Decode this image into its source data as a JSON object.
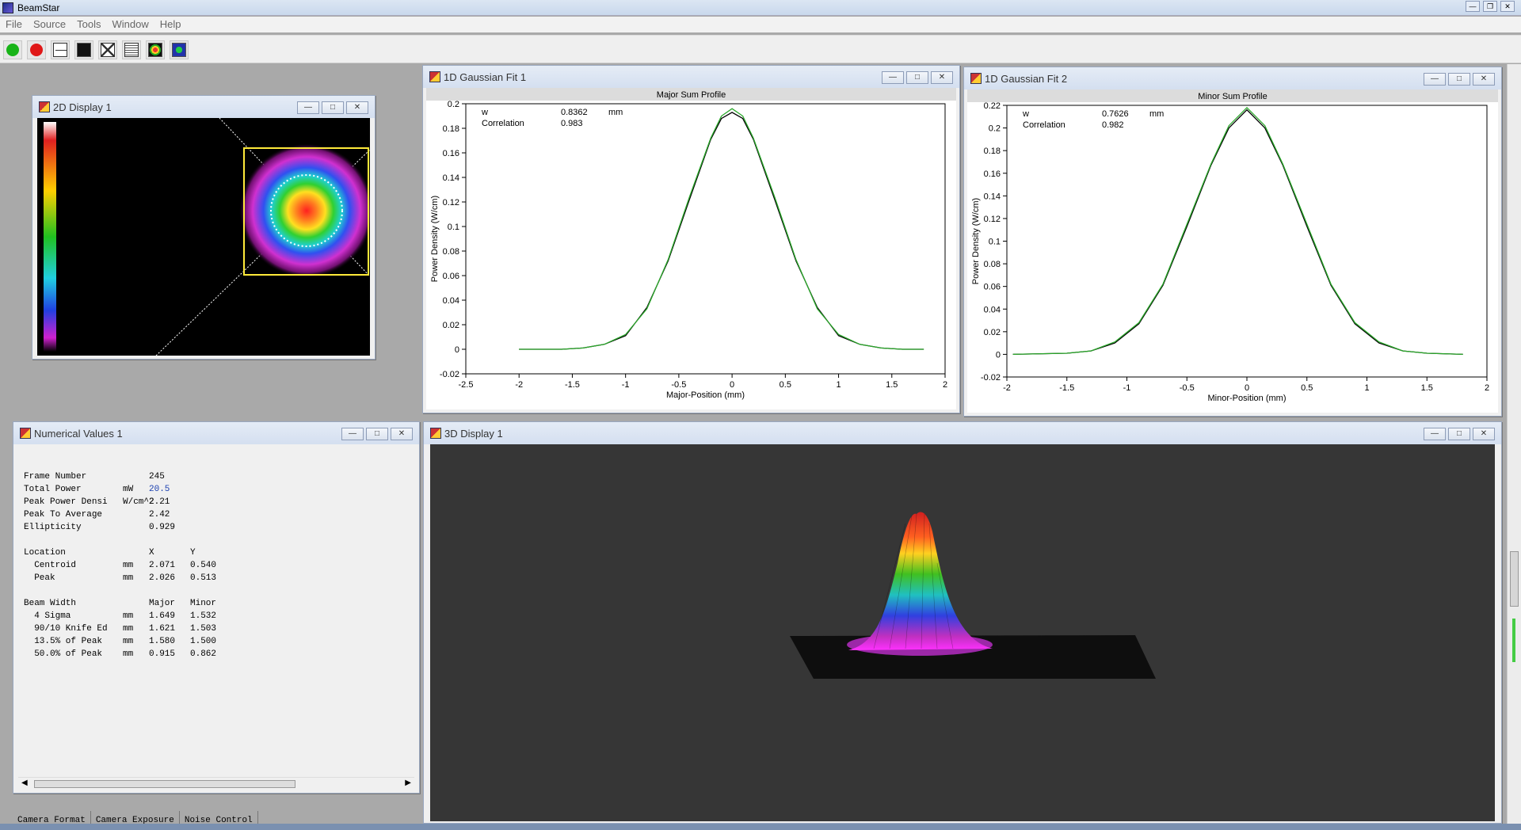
{
  "app": {
    "title": "BeamStar"
  },
  "menu": [
    "File",
    "Source",
    "Tools",
    "Window",
    "Help"
  ],
  "toolbar": {
    "icons": [
      "start-icon",
      "stop-icon",
      "profile-icon",
      "display-2d-icon",
      "crosshair-icon",
      "numeric-icon",
      "display-3d-icon",
      "fit-icon"
    ]
  },
  "windows": {
    "display2d": {
      "title": "2D Display 1"
    },
    "gauss1": {
      "title": "1D Gaussian Fit 1"
    },
    "gauss2": {
      "title": "1D Gaussian Fit 2"
    },
    "numeric": {
      "title": "Numerical Values 1"
    },
    "display3d": {
      "title": "3D Display 1"
    }
  },
  "numeric": {
    "rows": [
      {
        "label": "Frame Number",
        "unit": "",
        "v1": "245",
        "v2": ""
      },
      {
        "label": "Total Power",
        "unit": "mW",
        "v1": "20.5",
        "v2": ""
      },
      {
        "label": "Peak Power Densi",
        "unit": "W/cm^2",
        "v1": "2.21",
        "v2": ""
      },
      {
        "label": "Peak To Average",
        "unit": "",
        "v1": "2.42",
        "v2": ""
      },
      {
        "label": "Ellipticity",
        "unit": "",
        "v1": "0.929",
        "v2": ""
      },
      {
        "label": "",
        "unit": "",
        "v1": "",
        "v2": ""
      },
      {
        "label": "Location",
        "unit": "",
        "v1": "X",
        "v2": "Y"
      },
      {
        "label": "  Centroid",
        "unit": "mm",
        "v1": "2.071",
        "v2": "0.540"
      },
      {
        "label": "  Peak",
        "unit": "mm",
        "v1": "2.026",
        "v2": "0.513"
      },
      {
        "label": "",
        "unit": "",
        "v1": "",
        "v2": ""
      },
      {
        "label": "Beam Width",
        "unit": "",
        "v1": "Major",
        "v2": "Minor"
      },
      {
        "label": "  4 Sigma",
        "unit": "mm",
        "v1": "1.649",
        "v2": "1.532"
      },
      {
        "label": "  90/10 Knife Ed",
        "unit": "mm",
        "v1": "1.621",
        "v2": "1.503"
      },
      {
        "label": "  13.5% of Peak",
        "unit": "mm",
        "v1": "1.580",
        "v2": "1.500"
      },
      {
        "label": "  50.0% of Peak",
        "unit": "mm",
        "v1": "0.915",
        "v2": "0.862"
      }
    ]
  },
  "tabs": [
    "Camera Format",
    "Camera Exposure",
    "Noise Control"
  ],
  "colors": {
    "fit_line": "#2aa82a",
    "data_line": "#000000",
    "accent_total_power": "#1a3fb0"
  },
  "chart_data": [
    {
      "type": "line",
      "title": "Major Sum Profile",
      "xlabel": "Major-Position (mm)",
      "ylabel": "Power Density (W/cm)",
      "xlim": [
        -2.5,
        2
      ],
      "ylim": [
        -0.02,
        0.2
      ],
      "xticks": [
        "-2.5",
        "-2",
        "-1.5",
        "-1",
        "-0.5",
        "0",
        "0.5",
        "1",
        "1.5",
        "2"
      ],
      "yticks": [
        "-0.02",
        "0",
        "0.02",
        "0.04",
        "0.06",
        "0.08",
        "0.1",
        "0.12",
        "0.14",
        "0.16",
        "0.18",
        "0.2"
      ],
      "annotations": [
        {
          "label": "w",
          "value": "0.8362",
          "unit": "mm"
        },
        {
          "label": "Correlation",
          "value": "0.983",
          "unit": ""
        }
      ],
      "series": [
        {
          "x": [
            -2.0,
            -1.6,
            -1.4,
            -1.2,
            -1.0,
            -0.8,
            -0.6,
            -0.4,
            -0.2,
            -0.1,
            0.0,
            0.1,
            0.2,
            0.4,
            0.6,
            0.8,
            1.0,
            1.2,
            1.4,
            1.6,
            1.8
          ],
          "y": [
            0.0,
            0.0,
            0.001,
            0.004,
            0.011,
            0.034,
            0.072,
            0.122,
            0.171,
            0.188,
            0.193,
            0.188,
            0.171,
            0.122,
            0.072,
            0.034,
            0.011,
            0.004,
            0.001,
            0.0,
            0.0
          ]
        },
        {
          "x": [
            -2.0,
            -1.6,
            -1.4,
            -1.2,
            -1.0,
            -0.8,
            -0.6,
            -0.4,
            -0.2,
            -0.1,
            0.0,
            0.1,
            0.2,
            0.4,
            0.6,
            0.8,
            1.0,
            1.2,
            1.4,
            1.6,
            1.8
          ],
          "y": [
            0.0,
            0.0,
            0.001,
            0.004,
            0.012,
            0.033,
            0.073,
            0.124,
            0.172,
            0.19,
            0.196,
            0.19,
            0.172,
            0.124,
            0.073,
            0.033,
            0.012,
            0.004,
            0.001,
            0.0,
            0.0
          ]
        }
      ]
    },
    {
      "type": "line",
      "title": "Minor Sum Profile",
      "xlabel": "Minor-Position (mm)",
      "ylabel": "Power Density (W/cm)",
      "xlim": [
        -2,
        2
      ],
      "ylim": [
        -0.02,
        0.22
      ],
      "xticks": [
        "-2",
        "-1.5",
        "-1",
        "-0.5",
        "0",
        "0.5",
        "1",
        "1.5",
        "2"
      ],
      "yticks": [
        "-0.02",
        "0",
        "0.02",
        "0.04",
        "0.06",
        "0.08",
        "0.1",
        "0.12",
        "0.14",
        "0.16",
        "0.18",
        "0.2",
        "0.22"
      ],
      "annotations": [
        {
          "label": "w",
          "value": "0.7626",
          "unit": "mm"
        },
        {
          "label": "Correlation",
          "value": "0.982",
          "unit": ""
        }
      ],
      "series": [
        {
          "x": [
            -1.95,
            -1.5,
            -1.3,
            -1.1,
            -0.9,
            -0.7,
            -0.5,
            -0.3,
            -0.15,
            0.0,
            0.15,
            0.3,
            0.5,
            0.7,
            0.9,
            1.1,
            1.3,
            1.5,
            1.8
          ],
          "y": [
            0.0,
            0.001,
            0.003,
            0.01,
            0.027,
            0.061,
            0.113,
            0.167,
            0.2,
            0.216,
            0.2,
            0.167,
            0.113,
            0.061,
            0.027,
            0.01,
            0.003,
            0.001,
            0.0
          ]
        },
        {
          "x": [
            -1.95,
            -1.5,
            -1.3,
            -1.1,
            -0.9,
            -0.7,
            -0.5,
            -0.3,
            -0.15,
            0.0,
            0.15,
            0.3,
            0.5,
            0.7,
            0.9,
            1.1,
            1.3,
            1.5,
            1.8
          ],
          "y": [
            0.0,
            0.001,
            0.003,
            0.011,
            0.028,
            0.062,
            0.115,
            0.168,
            0.202,
            0.218,
            0.202,
            0.168,
            0.115,
            0.062,
            0.028,
            0.011,
            0.003,
            0.001,
            0.0
          ]
        }
      ]
    }
  ]
}
